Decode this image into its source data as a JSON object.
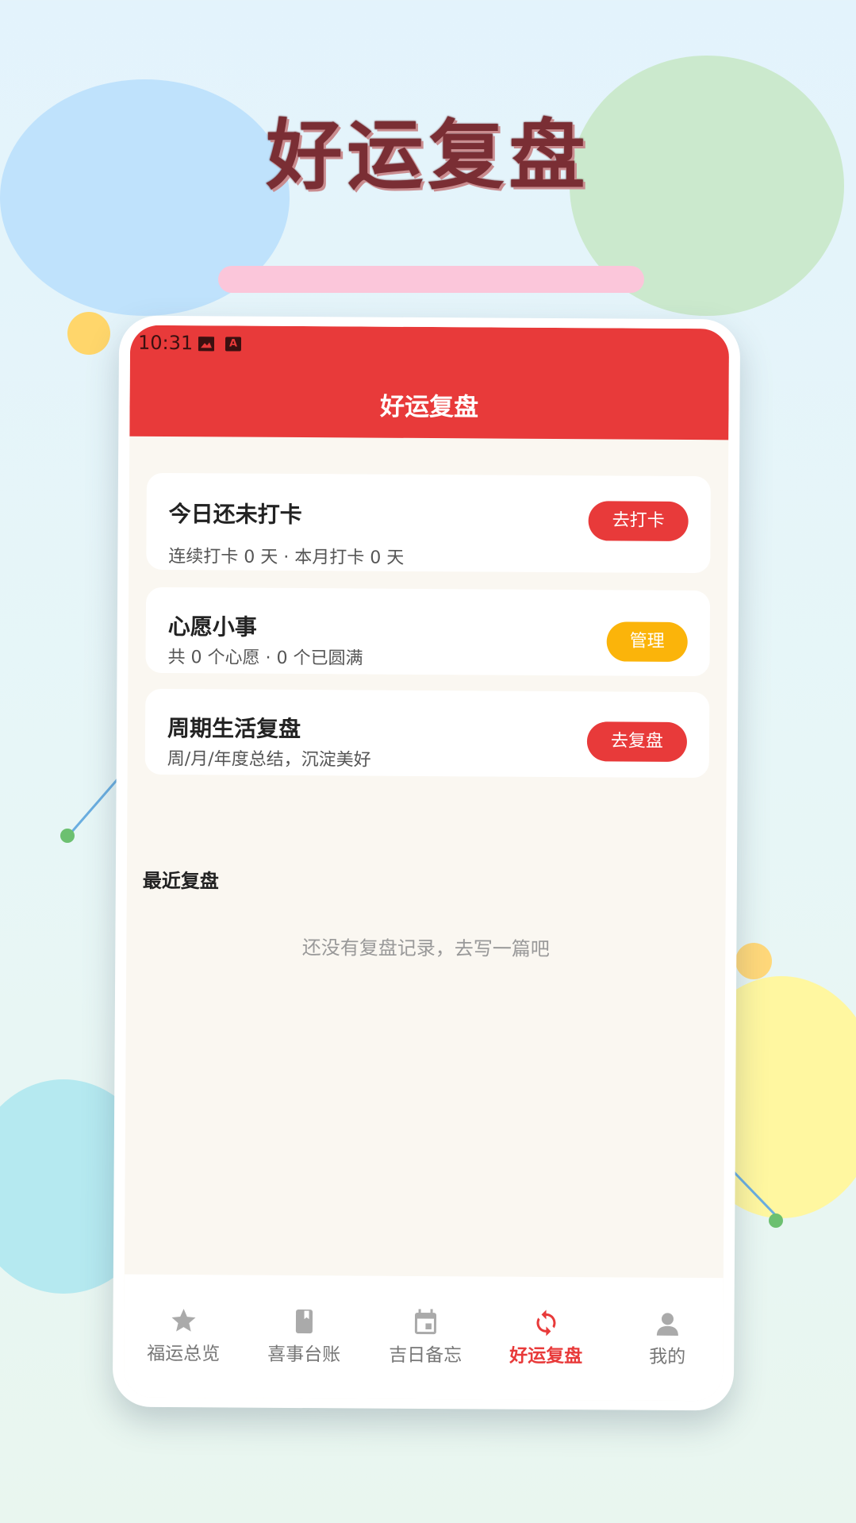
{
  "promo": {
    "title": "好运复盘"
  },
  "status_bar": {
    "time": "10:31",
    "icons": [
      "image-icon",
      "a-badge-icon"
    ]
  },
  "app_bar": {
    "title": "好运复盘"
  },
  "cards": {
    "checkin": {
      "title": "今日还未打卡",
      "subtitle": "连续打卡 0 天 · 本月打卡 0 天",
      "button": "去打卡",
      "button_color": "#e83a3a"
    },
    "wishes": {
      "title": "心愿小事",
      "subtitle": "共 0 个心愿 · 0 个已圆满",
      "button": "管理",
      "button_color": "#fbb40a"
    },
    "review": {
      "title": "周期生活复盘",
      "subtitle": "周/月/年度总结，沉淀美好",
      "button": "去复盘",
      "button_color": "#e83a3a"
    }
  },
  "recent": {
    "title": "最近复盘",
    "empty_text": "还没有复盘记录，去写一篇吧"
  },
  "tabs": [
    {
      "label": "福运总览",
      "icon": "star-icon",
      "active": false
    },
    {
      "label": "喜事台账",
      "icon": "book-icon",
      "active": false
    },
    {
      "label": "吉日备忘",
      "icon": "calendar-icon",
      "active": false
    },
    {
      "label": "好运复盘",
      "icon": "refresh-icon",
      "active": true
    },
    {
      "label": "我的",
      "icon": "person-icon",
      "active": false
    }
  ],
  "colors": {
    "accent": "#e83a3a",
    "manage": "#fbb40a",
    "title_text": "#7a2e34",
    "inactive_tab": "#aaaaaa"
  }
}
